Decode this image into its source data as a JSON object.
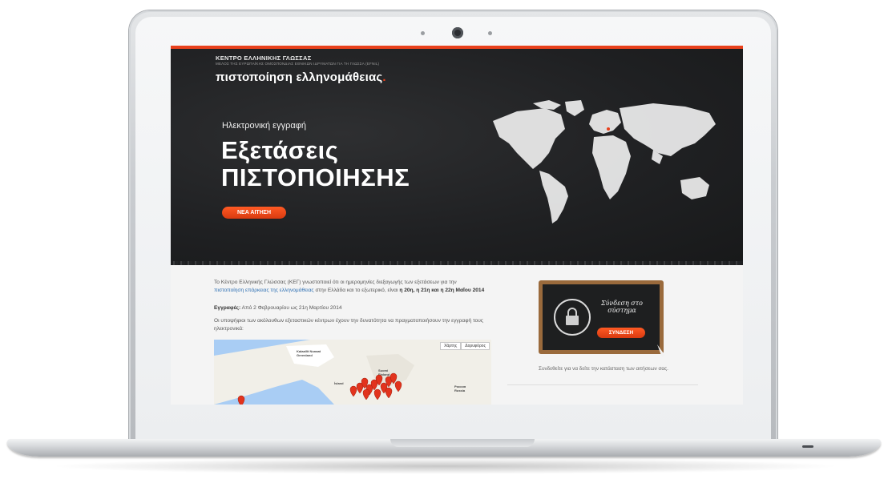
{
  "site": {
    "org_name": "ΚΕΝΤΡΟ ΕΛΛΗΝΙΚΗΣ ΓΛΩΣΣΑΣ",
    "org_sub": "ΜΕΛΟΣ ΤΗΣ ΕΥΡΩΠΑΪΚΗΣ ΟΜΟΣΠΟΝΔΙΑΣ ΕΘΝΙΚΩΝ ΙΔΡΥΜΑΤΩΝ ΓΙΑ ΤΗ ΓΛΩΣΣΑ (EFNIL)",
    "title": "πιστοποίηση ελληνομάθειας",
    "title_dot": "."
  },
  "hero": {
    "subtitle": "Ηλεκτρονική εγγραφή",
    "heading_line1": "Εξετάσεις",
    "heading_line2": "ΠΙΣΤΟΠΟΙΗΣΗΣ",
    "button_label": "ΝΕΑ ΑΙΤΗΣΗ"
  },
  "content": {
    "intro_1": "Το Κέντρο Ελληνικής Γλώσσας (ΚΕΓ) γνωστοποιεί ότι οι ημερομηνίες διεξαγωγής των εξετάσεων για την",
    "intro_link": "πιστοποίηση επάρκειας της ελληνομάθειας",
    "intro_2": "στην Ελλάδα και το εξωτερικό, είναι",
    "intro_dates": "η 20η, η 21η και η 22η Μαΐου 2014",
    "registrations_label": "Εγγραφές:",
    "registrations_value": "Από 2 Φεβρουαρίου ως 21η Μαρτίου 2014",
    "candidates_text": "Οι υποψήφιοι των ακόλουθων εξεταστικών κέντρων έχουν την δυνατότητα να πραγματοποιήσουν την εγγραφή τους ηλεκτρονικά:"
  },
  "map": {
    "btn_map": "Χάρτης",
    "btn_satellite": "Δορυφόρος",
    "labels": [
      "Kalaallit Nunaat Greenland",
      "Ísland",
      "Suomi Finland",
      "Россия Russia"
    ]
  },
  "login": {
    "script_text": "Σύνδεση στο σύστημα",
    "button_label": "ΣΥΝΔΕΣΗ",
    "caption": "Συνδεθείτε για να δείτε την κατάσταση των αιτήσεων σας."
  }
}
